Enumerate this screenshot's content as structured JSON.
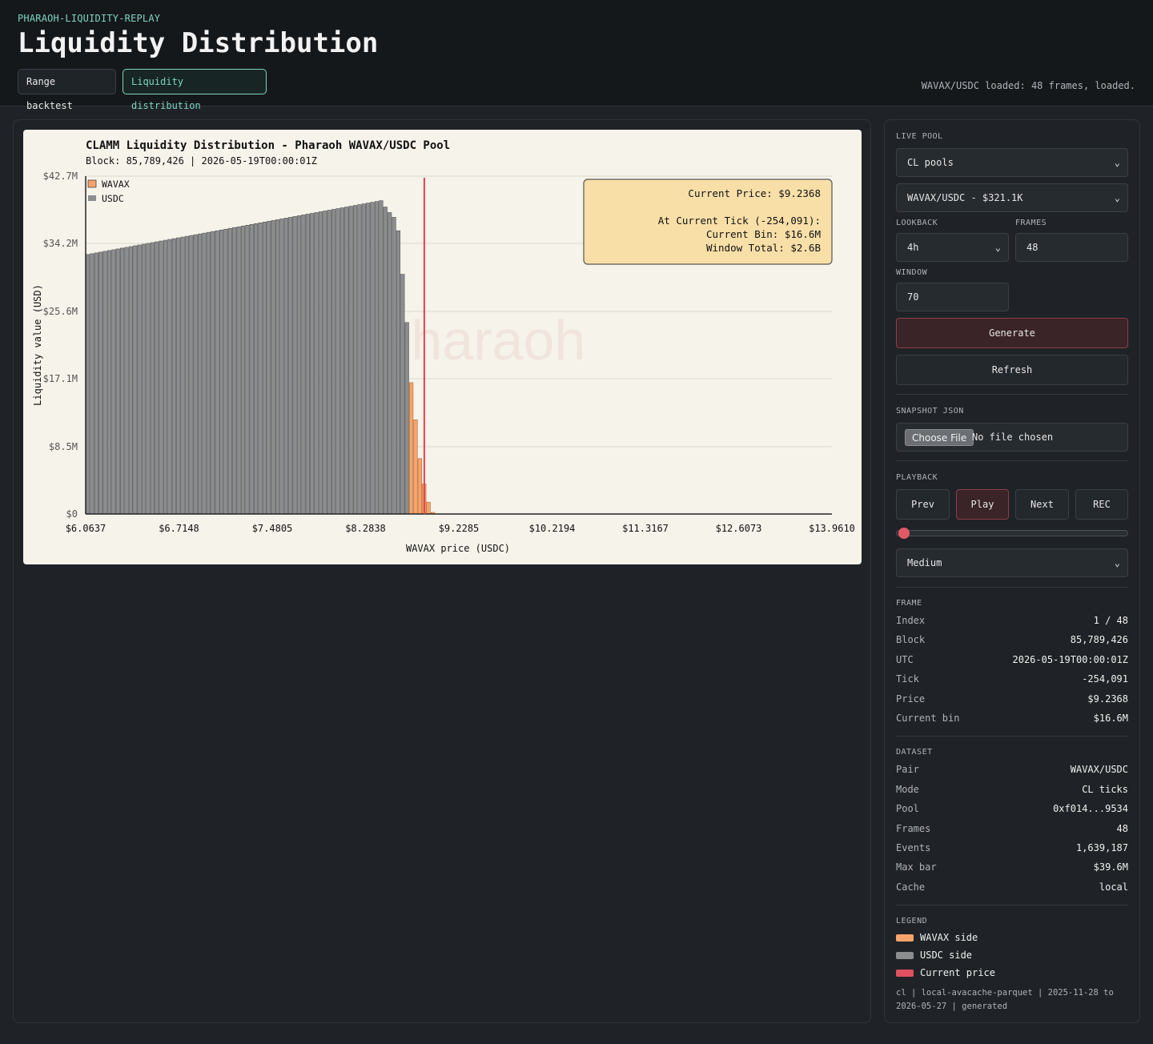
{
  "header": {
    "brand": "PHARAOH-LIQUIDITY-REPLAY",
    "title": "Liquidity Distribution",
    "tabs": [
      {
        "label": "Range backtest",
        "active": false
      },
      {
        "label": "Liquidity distribution",
        "active": true
      }
    ],
    "status": "WAVAX/USDC loaded: 48 frames, loaded."
  },
  "controls": {
    "live_pool_label": "LIVE POOL",
    "pool_type": "CL pools",
    "pool": "WAVAX/USDC - $321.1K",
    "lookback_label": "LOOKBACK",
    "lookback": "4h",
    "frames_label": "FRAMES",
    "frames": "48",
    "window_label": "WINDOW",
    "window": "70",
    "generate_label": "Generate",
    "refresh_label": "Refresh",
    "snapshot_label": "SNAPSHOT JSON",
    "choose_file_label": "Choose File",
    "no_file_label": "No file chosen",
    "playback_label": "PLAYBACK",
    "prev_label": "Prev",
    "play_label": "Play",
    "next_label": "Next",
    "rec_label": "REC",
    "playback_position": 0,
    "speed": "Medium"
  },
  "frame": {
    "label": "FRAME",
    "rows": [
      {
        "k": "Index",
        "v": "1 / 48"
      },
      {
        "k": "Block",
        "v": "85,789,426"
      },
      {
        "k": "UTC",
        "v": "2026-05-19T00:00:01Z"
      },
      {
        "k": "Tick",
        "v": "-254,091"
      },
      {
        "k": "Price",
        "v": "$9.2368"
      },
      {
        "k": "Current bin",
        "v": "$16.6M"
      }
    ]
  },
  "dataset": {
    "label": "DATASET",
    "rows": [
      {
        "k": "Pair",
        "v": "WAVAX/USDC"
      },
      {
        "k": "Mode",
        "v": "CL ticks"
      },
      {
        "k": "Pool",
        "v": "0xf014...9534"
      },
      {
        "k": "Frames",
        "v": "48"
      },
      {
        "k": "Events",
        "v": "1,639,187"
      },
      {
        "k": "Max bar",
        "v": "$39.6M"
      },
      {
        "k": "Cache",
        "v": "local"
      }
    ]
  },
  "legend": {
    "label": "LEGEND",
    "items": [
      {
        "label": "WAVAX side",
        "color": "#f6a46c"
      },
      {
        "label": "USDC side",
        "color": "#8b8d8f"
      },
      {
        "label": "Current price",
        "color": "#e0505e"
      }
    ],
    "footnote": "cl | local-avacache-parquet | 2025-11-28 to 2026-05-27 | generated"
  },
  "chart_data": {
    "type": "bar",
    "title": "CLAMM Liquidity Distribution - Pharaoh WAVAX/USDC Pool",
    "subtitle": "Block: 85,789,426 | 2026-05-19T00:00:01Z",
    "xlabel": "WAVAX price (USDC)",
    "ylabel": "Liquidity value (USD)",
    "watermark": "Pharaoh",
    "xlim": [
      6.0637,
      13.961
    ],
    "ylim": [
      0,
      42.7
    ],
    "y_ticks": [
      {
        "value": 0,
        "label": "$0"
      },
      {
        "value": 8.5,
        "label": "$8.5M"
      },
      {
        "value": 17.1,
        "label": "$17.1M"
      },
      {
        "value": 25.6,
        "label": "$25.6M"
      },
      {
        "value": 34.2,
        "label": "$34.2M"
      },
      {
        "value": 42.7,
        "label": "$42.7M"
      }
    ],
    "x_ticks": [
      "$6.0637",
      "$6.7148",
      "$7.4805",
      "$8.2838",
      "$9.2285",
      "$10.2194",
      "$11.3167",
      "$12.6073",
      "$13.9610"
    ],
    "grid": true,
    "legend_position": "top-left",
    "current_price": 9.2368,
    "current_price_index": 78,
    "annotation": [
      "Current Price: $9.2368",
      "",
      "At Current Tick (-254,091):",
      "Current Bin: $16.6M",
      "Window Total: $2.6B"
    ],
    "series": [
      {
        "name": "USDC",
        "color": "#8b8d8f",
        "values": [
          32.8,
          32.9,
          33.0,
          33.1,
          33.2,
          33.3,
          33.4,
          33.5,
          33.6,
          33.7,
          33.8,
          33.9,
          34.0,
          34.1,
          34.2,
          34.3,
          34.4,
          34.5,
          34.6,
          34.7,
          34.8,
          34.9,
          35.0,
          35.1,
          35.2,
          35.3,
          35.4,
          35.5,
          35.6,
          35.7,
          35.8,
          35.9,
          36.0,
          36.1,
          36.2,
          36.3,
          36.4,
          36.5,
          36.6,
          36.7,
          36.8,
          36.9,
          37.0,
          37.1,
          37.2,
          37.3,
          37.4,
          37.5,
          37.6,
          37.7,
          37.8,
          37.9,
          38.0,
          38.1,
          38.2,
          38.3,
          38.4,
          38.5,
          38.6,
          38.7,
          38.8,
          38.9,
          39.0,
          39.1,
          39.2,
          39.3,
          39.4,
          39.5,
          39.6,
          38.8,
          38.1,
          37.5,
          35.8,
          30.3,
          24.2,
          0,
          0,
          0,
          0,
          0,
          0,
          0,
          0,
          0,
          0,
          0,
          0,
          0,
          0,
          0,
          0,
          0,
          0,
          0,
          0,
          0,
          0,
          0,
          0,
          0,
          0,
          0,
          0,
          0,
          0,
          0,
          0,
          0,
          0,
          0,
          0,
          0,
          0,
          0,
          0,
          0,
          0,
          0,
          0,
          0,
          0,
          0,
          0,
          0,
          0,
          0,
          0,
          0,
          0,
          0,
          0,
          0,
          0,
          0,
          0,
          0,
          0,
          0,
          0,
          0,
          0,
          0,
          0,
          0,
          0,
          0,
          0,
          0,
          0,
          0,
          0,
          0,
          0,
          0,
          0,
          0,
          0,
          0,
          0,
          0,
          0,
          0,
          0,
          0,
          0,
          0,
          0,
          0,
          0,
          0,
          0,
          0,
          0
        ]
      },
      {
        "name": "WAVAX",
        "color": "#f6a46c",
        "values": [
          0,
          0,
          0,
          0,
          0,
          0,
          0,
          0,
          0,
          0,
          0,
          0,
          0,
          0,
          0,
          0,
          0,
          0,
          0,
          0,
          0,
          0,
          0,
          0,
          0,
          0,
          0,
          0,
          0,
          0,
          0,
          0,
          0,
          0,
          0,
          0,
          0,
          0,
          0,
          0,
          0,
          0,
          0,
          0,
          0,
          0,
          0,
          0,
          0,
          0,
          0,
          0,
          0,
          0,
          0,
          0,
          0,
          0,
          0,
          0,
          0,
          0,
          0,
          0,
          0,
          0,
          0,
          0,
          0,
          0,
          0,
          0,
          0,
          0,
          0,
          16.6,
          11.9,
          7.0,
          3.8,
          1.5,
          0.2,
          0,
          0,
          0,
          0,
          0,
          0,
          0,
          0,
          0,
          0,
          0,
          0,
          0,
          0,
          0,
          0,
          0,
          0,
          0,
          0,
          0,
          0,
          0,
          0,
          0,
          0,
          0,
          0,
          0,
          0,
          0,
          0,
          0,
          0,
          0,
          0,
          0,
          0,
          0,
          0,
          0,
          0,
          0,
          0,
          0,
          0,
          0,
          0,
          0,
          0,
          0,
          0,
          0,
          0,
          0,
          0,
          0,
          0,
          0,
          0,
          0,
          0,
          0,
          0,
          0,
          0,
          0,
          0,
          0,
          0,
          0,
          0,
          0,
          0,
          0,
          0,
          0,
          0,
          0,
          0,
          0,
          0,
          0,
          0,
          0,
          0,
          0,
          0,
          0,
          0,
          0
        ]
      }
    ]
  }
}
